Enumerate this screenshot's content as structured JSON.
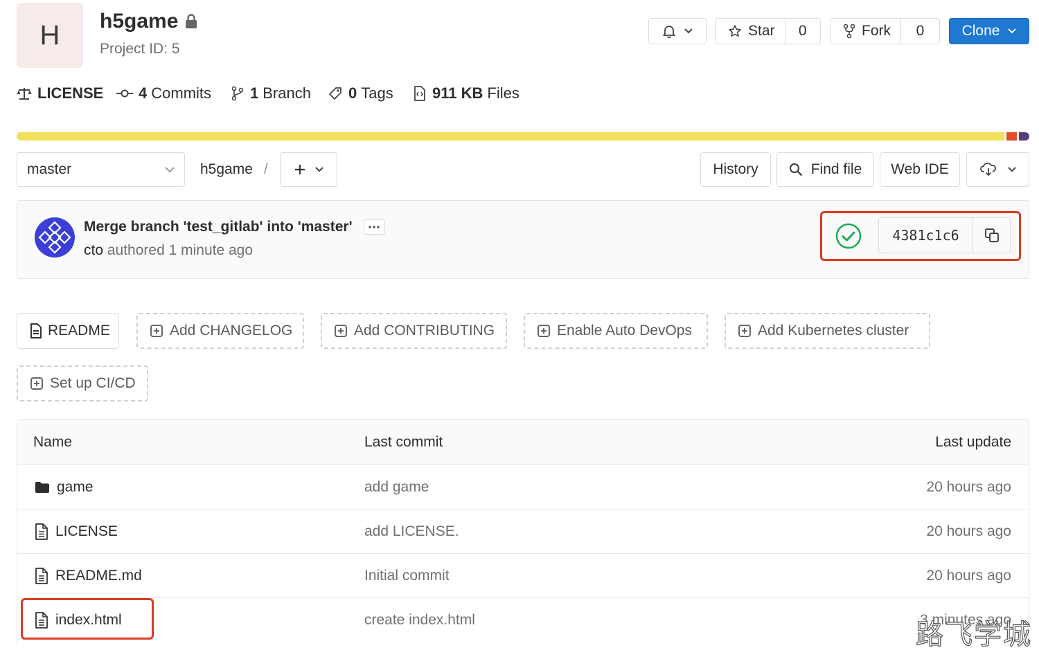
{
  "project": {
    "avatar_letter": "H",
    "name": "h5game",
    "id_label": "Project ID: 5"
  },
  "actions": {
    "star_label": "Star",
    "star_count": "0",
    "fork_label": "Fork",
    "fork_count": "0",
    "clone_label": "Clone"
  },
  "stats": {
    "license": "LICENSE",
    "commits_count": "4",
    "commits_label": "Commits",
    "branch_count": "1",
    "branch_label": "Branch",
    "tags_count": "0",
    "tags_label": "Tags",
    "files_size": "911 KB",
    "files_label": "Files"
  },
  "language_bar": {
    "segments": [
      {
        "color": "#f1e05a",
        "fraction": 0.98
      },
      {
        "color": "#e34c26",
        "fraction": 0.01
      },
      {
        "color": "#563d7c",
        "fraction": 0.01
      }
    ]
  },
  "toolbar": {
    "branch": "master",
    "path_root": "h5game",
    "path_sep": "/",
    "history": "History",
    "find_file": "Find file",
    "web_ide": "Web IDE"
  },
  "last_commit": {
    "message": "Merge branch 'test_gitlab' into 'master'",
    "author": "cto",
    "meta": "authored 1 minute ago",
    "sha": "4381c1c6",
    "status": "success"
  },
  "quick_actions": {
    "readme": "README",
    "add_changelog": "Add CHANGELOG",
    "add_contributing": "Add CONTRIBUTING",
    "enable_devops": "Enable Auto DevOps",
    "add_k8s": "Add Kubernetes cluster",
    "setup_cicd": "Set up CI/CD"
  },
  "file_table": {
    "headers": {
      "name": "Name",
      "last_commit": "Last commit",
      "last_update": "Last update"
    },
    "rows": [
      {
        "type": "folder",
        "name": "game",
        "commit": "add game",
        "updated": "20 hours ago"
      },
      {
        "type": "file",
        "name": "LICENSE",
        "commit": "add LICENSE.",
        "updated": "20 hours ago"
      },
      {
        "type": "file",
        "name": "README.md",
        "commit": "Initial commit",
        "updated": "20 hours ago"
      },
      {
        "type": "file",
        "name": "index.html",
        "commit": "create index.html",
        "updated": "3 minutes ago"
      }
    ]
  },
  "watermark": "路飞学城",
  "colors": {
    "accent": "#1f78d1",
    "highlight_border": "#db3b21",
    "success": "#1aaa55"
  }
}
